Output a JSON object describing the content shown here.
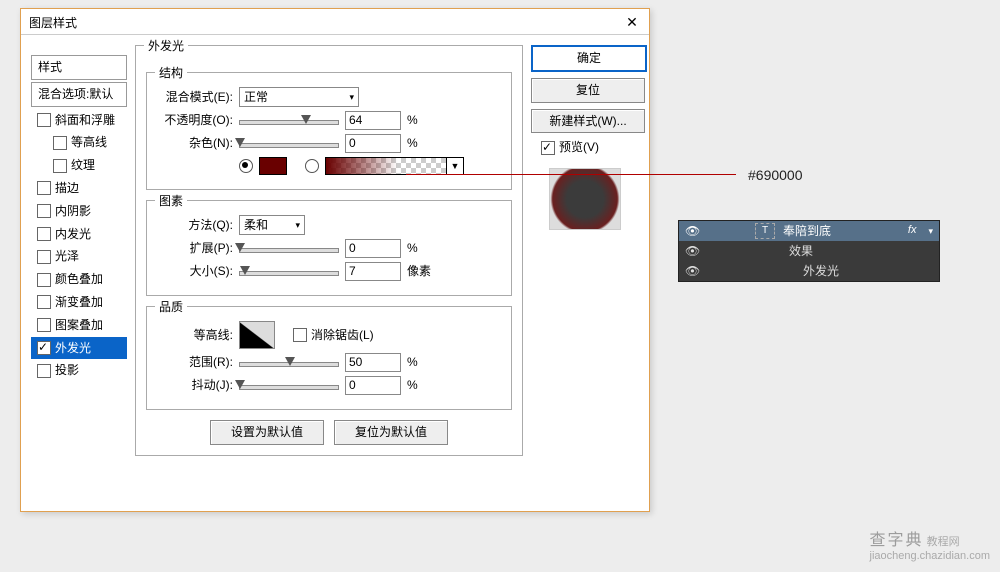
{
  "dialog": {
    "title": "图层样式",
    "buttons": {
      "ok": "确定",
      "cancel": "复位",
      "newStyle": "新建样式(W)...",
      "preview": "预览(V)"
    }
  },
  "sidebar": {
    "styles": "样式",
    "blendDefault": "混合选项:默认",
    "items": [
      {
        "label": "斜面和浮雕",
        "indent": 0
      },
      {
        "label": "等高线",
        "indent": 1
      },
      {
        "label": "纹理",
        "indent": 1
      },
      {
        "label": "描边",
        "indent": 0
      },
      {
        "label": "内阴影",
        "indent": 0
      },
      {
        "label": "内发光",
        "indent": 0
      },
      {
        "label": "光泽",
        "indent": 0
      },
      {
        "label": "颜色叠加",
        "indent": 0
      },
      {
        "label": "渐变叠加",
        "indent": 0
      },
      {
        "label": "图案叠加",
        "indent": 0
      },
      {
        "label": "外发光",
        "indent": 0,
        "selected": true,
        "checked": true
      },
      {
        "label": "投影",
        "indent": 0
      }
    ]
  },
  "panel": {
    "title": "外发光",
    "group1": "结构",
    "blendMode": {
      "label": "混合模式(E):",
      "value": "正常"
    },
    "opacity": {
      "label": "不透明度(O):",
      "value": "64",
      "pct": "%",
      "pos": 64
    },
    "noise": {
      "label": "杂色(N):",
      "value": "0",
      "pct": "%",
      "pos": 0
    },
    "group2": "图素",
    "method": {
      "label": "方法(Q):",
      "value": "柔和"
    },
    "spread": {
      "label": "扩展(P):",
      "value": "0",
      "pct": "%",
      "pos": 0
    },
    "size": {
      "label": "大小(S):",
      "value": "7",
      "unit": "像素",
      "pos": 5
    },
    "group3": "品质",
    "contour": {
      "label": "等高线:"
    },
    "antiAlias": "消除锯齿(L)",
    "range": {
      "label": "范围(R):",
      "value": "50",
      "pct": "%",
      "pos": 50
    },
    "jitter": {
      "label": "抖动(J):",
      "value": "0",
      "pct": "%",
      "pos": 0
    },
    "btnDefault": "设置为默认值",
    "btnReset": "复位为默认值"
  },
  "annotation": {
    "hex": "#690000"
  },
  "layers": {
    "name": "奉陪到底",
    "fx": "fx",
    "effects": "效果",
    "child": "外发光"
  },
  "watermark": {
    "cn": "查字典",
    "en": "教程网",
    "url": "jiaocheng.chazidian.com"
  }
}
